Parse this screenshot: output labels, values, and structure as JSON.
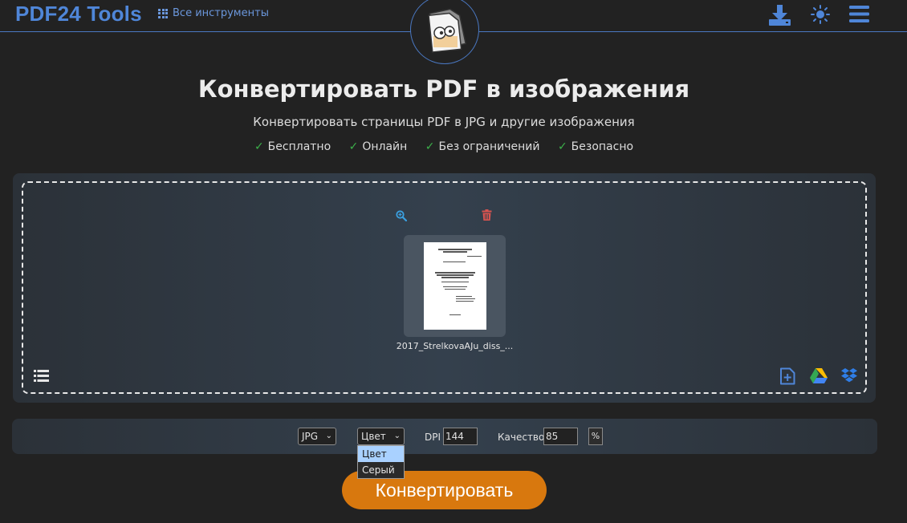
{
  "header": {
    "brand": "PDF24 Tools",
    "all_tools_label": "Все инструменты",
    "icons": [
      "grid-icon",
      "download-icon",
      "theme-toggle-icon",
      "menu-icon",
      "pdf-image-logo"
    ]
  },
  "hero": {
    "title": "Конвертировать PDF в изображения",
    "subtitle": "Конвертировать страницы PDF в JPG и другие изображения",
    "features": [
      "Бесплатно",
      "Онлайн",
      "Без ограничений",
      "Безопасно"
    ]
  },
  "dropzone": {
    "file_name": "2017_StrelkovaAJu_diss_...",
    "icons": [
      "zoom-icon",
      "trash-icon",
      "list-view-icon",
      "add-file-icon",
      "google-drive-icon",
      "dropbox-icon"
    ]
  },
  "options": {
    "format": "JPG",
    "color_mode": "Цвет",
    "color_mode_options": [
      "Цвет",
      "Серый"
    ],
    "dpi_label": "DPI",
    "dpi_value": "144",
    "quality_label": "Качество",
    "quality_value": "85",
    "quality_unit": "%"
  },
  "actions": {
    "convert_label": "Конвертировать"
  },
  "colors": {
    "background": "#222222",
    "brand_blue": "#4f86d8",
    "accent_orange": "#d8780e",
    "check_green": "#3cb04a",
    "trash_red": "#d9534f"
  }
}
